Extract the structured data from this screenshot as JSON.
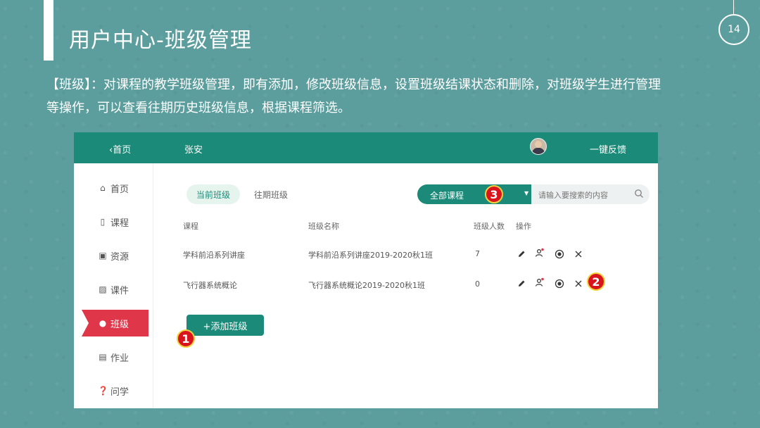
{
  "slide": {
    "title": "用户中心-班级管理",
    "page_number": "14",
    "description": "【班级】：对课程的教学班级管理，即有添加，修改班级信息，设置班级结课状态和删除，对班级学生进行管理等操作，可以查看往期历史班级信息，根据课程筛选。"
  },
  "topbar": {
    "back_label": "首页",
    "user_name": "张安",
    "feedback_label": "一键反馈"
  },
  "sidebar": {
    "items": [
      {
        "label": "首页",
        "icon": "home-icon"
      },
      {
        "label": "课程",
        "icon": "book-icon"
      },
      {
        "label": "资源",
        "icon": "box-icon"
      },
      {
        "label": "课件",
        "icon": "ppt-icon"
      },
      {
        "label": "班级",
        "icon": "class-icon",
        "active": true
      },
      {
        "label": "作业",
        "icon": "word-icon"
      },
      {
        "label": "问学",
        "icon": "question-icon"
      }
    ]
  },
  "tabs": {
    "current": "当前班级",
    "past": "往期班级"
  },
  "filter": {
    "course_select": "全部课程",
    "search_placeholder": "请输入要搜索的内容"
  },
  "table": {
    "headers": {
      "course": "课程",
      "class_name": "班级名称",
      "count": "班级人数",
      "actions": "操作"
    },
    "rows": [
      {
        "course": "学科前沿系列讲座",
        "class_name": "学科前沿系列讲座2019-2020秋1班",
        "count": "7"
      },
      {
        "course": "飞行器系统概论",
        "class_name": "飞行器系统概论2019-2020秋1班",
        "count": "0"
      }
    ]
  },
  "add_button": "+添加班级",
  "badges": {
    "b1": "1",
    "b2": "2",
    "b3": "3"
  },
  "colors": {
    "accent": "#1b8a78",
    "active": "#e0364a",
    "badge": "#d8141d"
  }
}
